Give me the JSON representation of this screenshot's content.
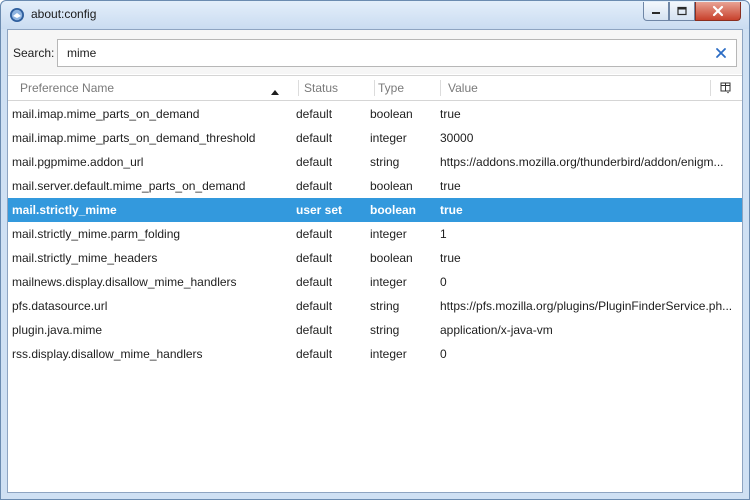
{
  "window": {
    "title": "about:config"
  },
  "search": {
    "label": "Search:",
    "value": "mime"
  },
  "columns": {
    "name": "Preference Name",
    "status": "Status",
    "type": "Type",
    "value": "Value",
    "sorted_by": "name",
    "sort_direction": "ascending"
  },
  "rows": [
    {
      "name": "mail.imap.mime_parts_on_demand",
      "status": "default",
      "type": "boolean",
      "value": "true"
    },
    {
      "name": "mail.imap.mime_parts_on_demand_threshold",
      "status": "default",
      "type": "integer",
      "value": "30000"
    },
    {
      "name": "mail.pgpmime.addon_url",
      "status": "default",
      "type": "string",
      "value": "https://addons.mozilla.org/thunderbird/addon/enigm..."
    },
    {
      "name": "mail.server.default.mime_parts_on_demand",
      "status": "default",
      "type": "boolean",
      "value": "true"
    },
    {
      "name": "mail.strictly_mime",
      "status": "user set",
      "type": "boolean",
      "value": "true"
    },
    {
      "name": "mail.strictly_mime.parm_folding",
      "status": "default",
      "type": "integer",
      "value": "1"
    },
    {
      "name": "mail.strictly_mime_headers",
      "status": "default",
      "type": "boolean",
      "value": "true"
    },
    {
      "name": "mailnews.display.disallow_mime_handlers",
      "status": "default",
      "type": "integer",
      "value": "0"
    },
    {
      "name": "pfs.datasource.url",
      "status": "default",
      "type": "string",
      "value": "https://pfs.mozilla.org/plugins/PluginFinderService.ph..."
    },
    {
      "name": "plugin.java.mime",
      "status": "default",
      "type": "string",
      "value": "application/x-java-vm"
    },
    {
      "name": "rss.display.disallow_mime_handlers",
      "status": "default",
      "type": "integer",
      "value": "0"
    }
  ],
  "selected_row": 4,
  "icons": {
    "app": "thunderbird-icon",
    "clear": "close-icon",
    "sort": "sort-ascending-icon",
    "column_picker": "column-picker-icon"
  },
  "colors": {
    "selection": "#3399dd",
    "clear_icon": "#2b6cc4"
  }
}
